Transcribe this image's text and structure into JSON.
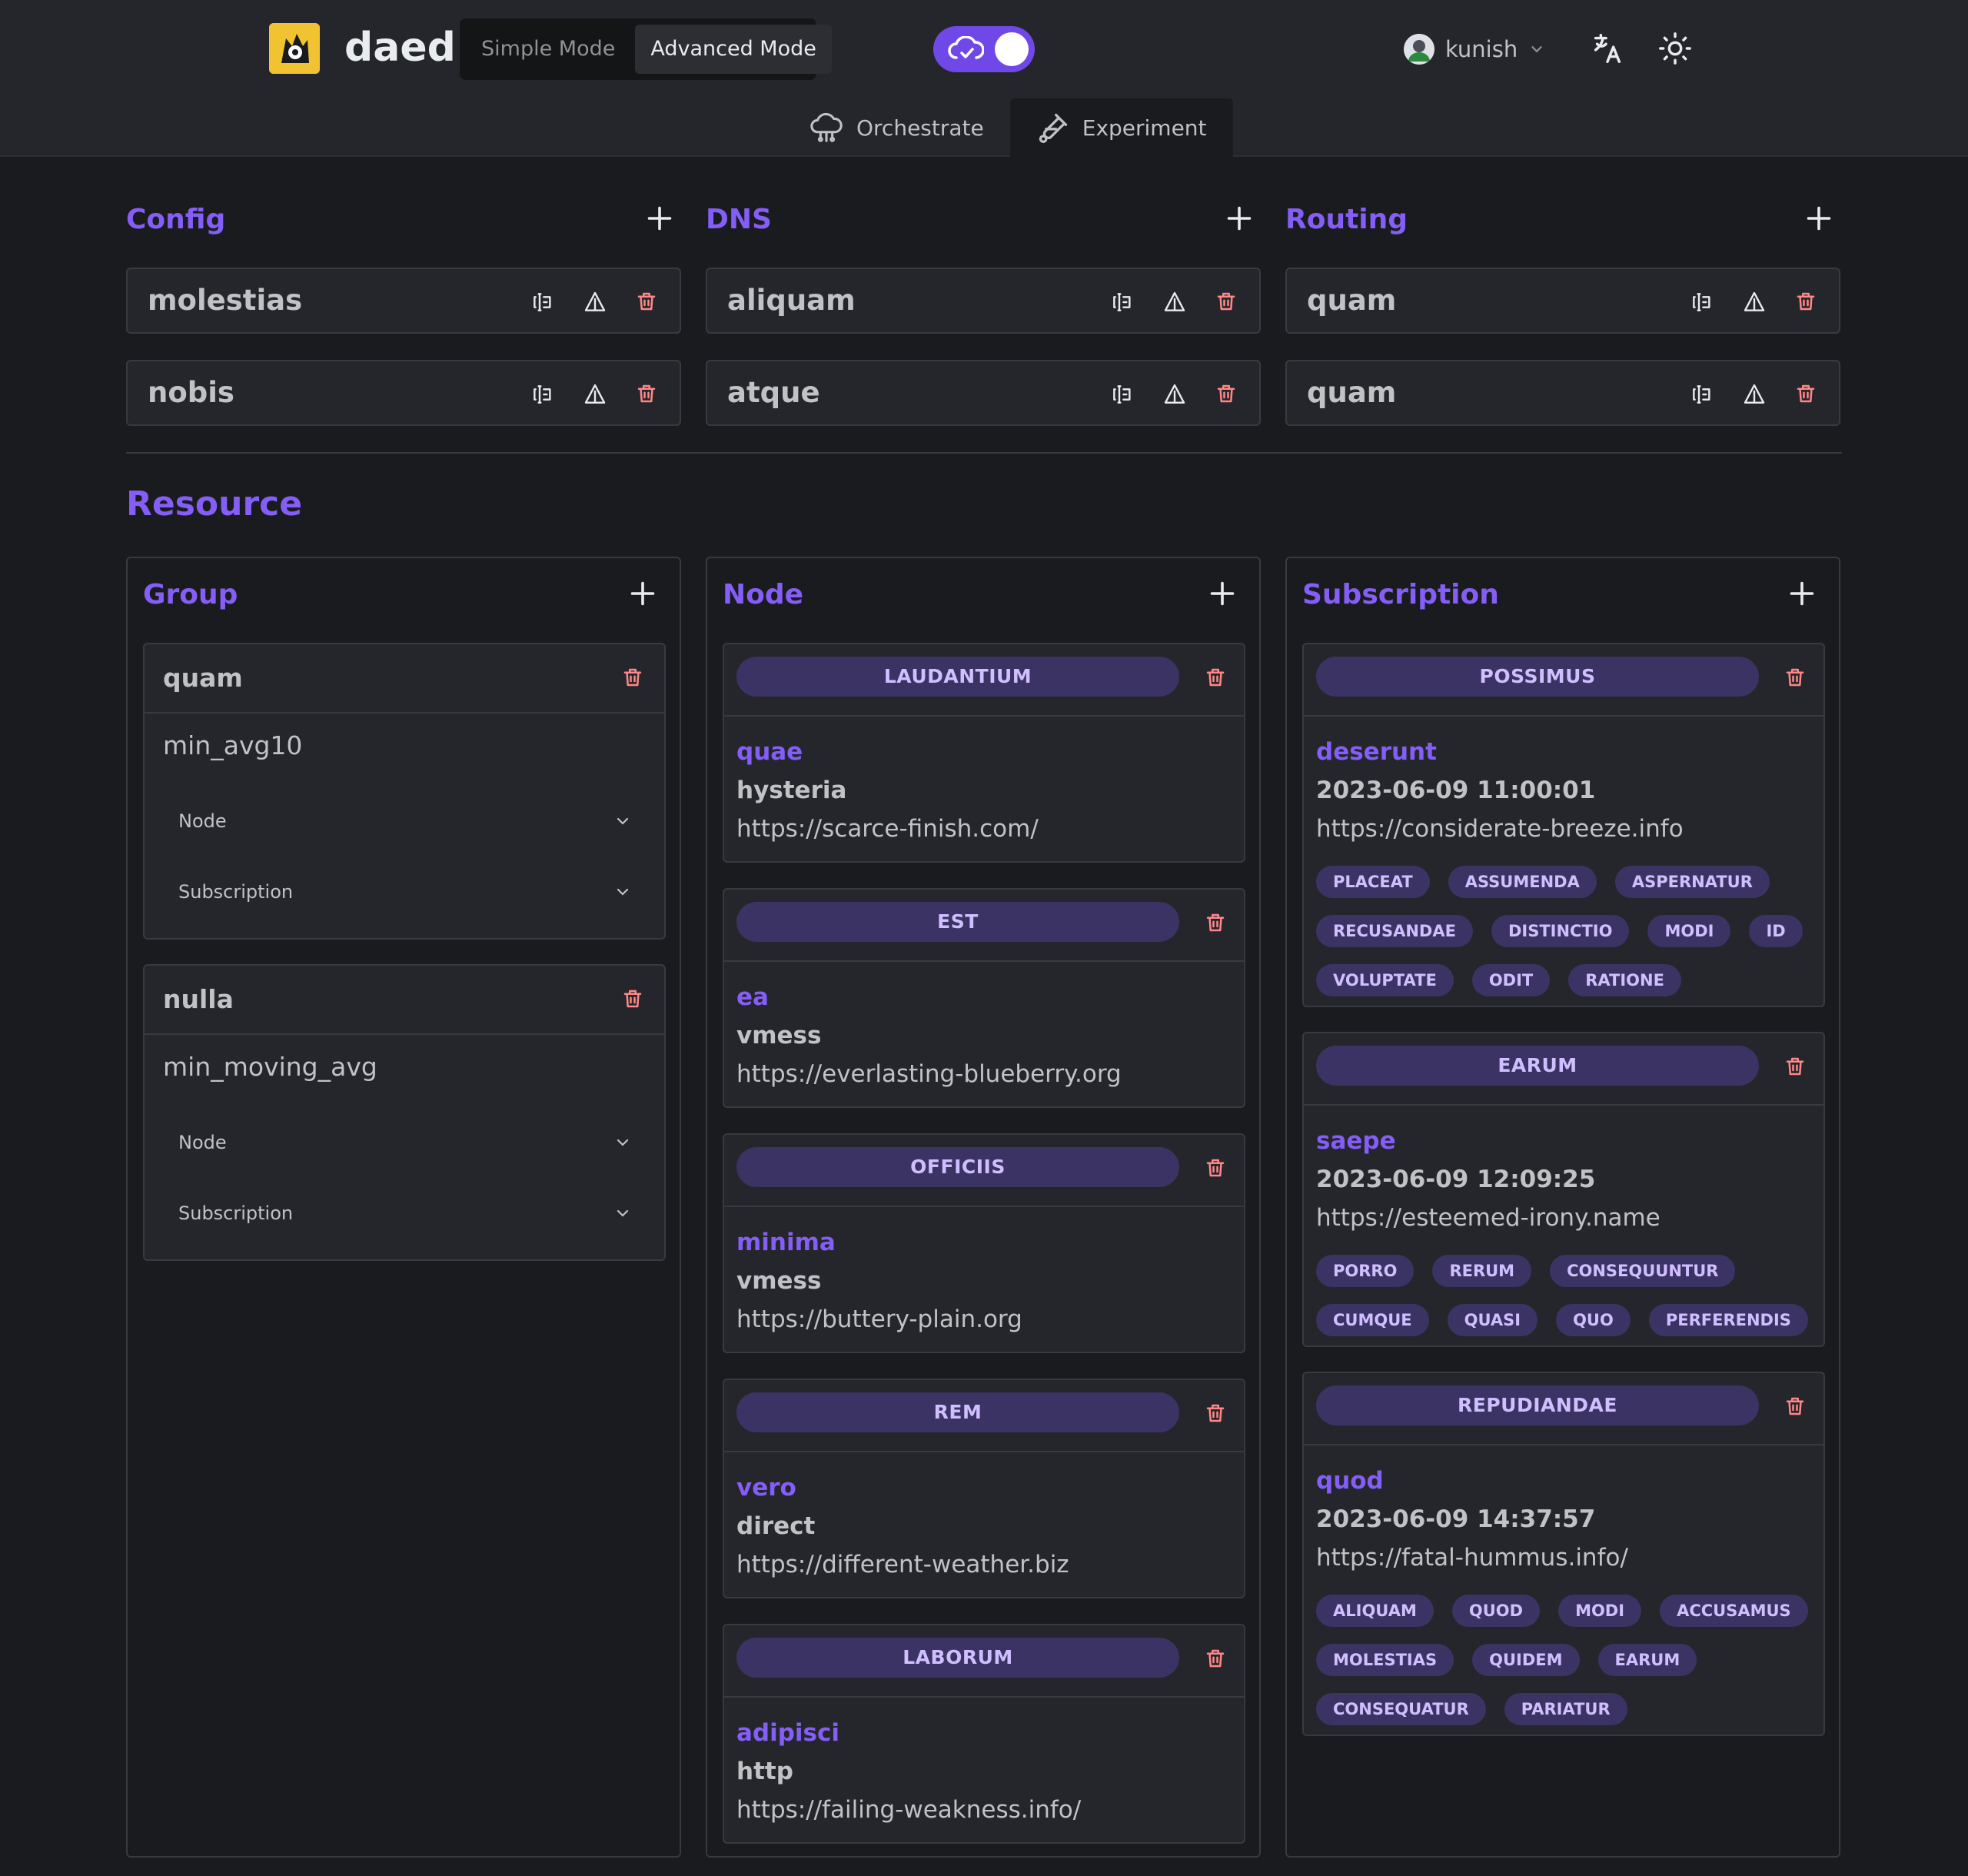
{
  "app": {
    "name": "daed"
  },
  "header": {
    "modes": [
      "Simple Mode",
      "Advanced Mode"
    ],
    "active_mode": "Advanced Mode",
    "user": "kunish",
    "tabs": [
      "Orchestrate",
      "Experiment"
    ],
    "active_tab": "Experiment",
    "accent": "#7048e8"
  },
  "config": {
    "title": "Config",
    "items": [
      "molestias",
      "nobis"
    ]
  },
  "dns": {
    "title": "DNS",
    "items": [
      "aliquam",
      "atque"
    ]
  },
  "routing": {
    "title": "Routing",
    "items": [
      "quam",
      "quam"
    ]
  },
  "resource": {
    "title": "Resource",
    "group": {
      "title": "Group",
      "cards": [
        {
          "name": "quam",
          "policy": "min_avg10",
          "sections": [
            "Node",
            "Subscription"
          ]
        },
        {
          "name": "nulla",
          "policy": "min_moving_avg",
          "sections": [
            "Node",
            "Subscription"
          ]
        }
      ]
    },
    "node": {
      "title": "Node",
      "cards": [
        {
          "tag": "LAUDANTIUM",
          "name": "quae",
          "protocol": "hysteria",
          "url": "https://scarce-finish.com/"
        },
        {
          "tag": "EST",
          "name": "ea",
          "protocol": "vmess",
          "url": "https://everlasting-blueberry.org"
        },
        {
          "tag": "OFFICIIS",
          "name": "minima",
          "protocol": "vmess",
          "url": "https://buttery-plain.org"
        },
        {
          "tag": "REM",
          "name": "vero",
          "protocol": "direct",
          "url": "https://different-weather.biz"
        },
        {
          "tag": "LABORUM",
          "name": "adipisci",
          "protocol": "http",
          "url": "https://failing-weakness.info/"
        }
      ]
    },
    "subscription": {
      "title": "Subscription",
      "cards": [
        {
          "tag": "POSSIMUS",
          "name": "deserunt",
          "updated": "2023-06-09 11:00:01",
          "url": "https://considerate-breeze.info",
          "tags": [
            "PLACEAT",
            "ASSUMENDA",
            "ASPERNATUR",
            "RECUSANDAE",
            "DISTINCTIO",
            "MODI",
            "ID",
            "VOLUPTATE",
            "ODIT",
            "RATIONE"
          ]
        },
        {
          "tag": "EARUM",
          "name": "saepe",
          "updated": "2023-06-09 12:09:25",
          "url": "https://esteemed-irony.name",
          "tags": [
            "PORRO",
            "RERUM",
            "CONSEQUUNTUR",
            "CUMQUE",
            "QUASI",
            "QUO",
            "PERFERENDIS"
          ]
        },
        {
          "tag": "REPUDIANDAE",
          "name": "quod",
          "updated": "2023-06-09 14:37:57",
          "url": "https://fatal-hummus.info/",
          "tags": [
            "ALIQUAM",
            "QUOD",
            "MODI",
            "ACCUSAMUS",
            "MOLESTIAS",
            "QUIDEM",
            "EARUM",
            "CONSEQUATUR",
            "PARIATUR"
          ]
        }
      ]
    }
  }
}
